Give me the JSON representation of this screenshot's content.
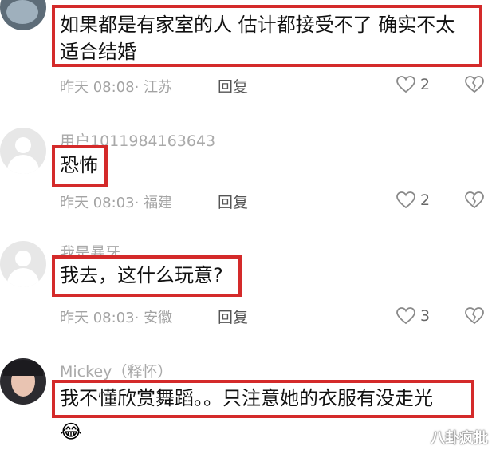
{
  "comments": [
    {
      "text_line1": "如果都是有家室的人 估计都接受不了 确实不太",
      "text_line2": "适合结婚",
      "time": "昨天 08:08",
      "location": "江苏",
      "reply": "回复",
      "likes": "2"
    },
    {
      "username": "用户1011984163643",
      "text": "恐怖",
      "time": "昨天 08:03",
      "location": "福建",
      "reply": "回复",
      "likes": "2"
    },
    {
      "username": "我是暴牙",
      "text": "我去，这什么玩意?",
      "time": "昨天 08:03",
      "location": "安徽",
      "reply": "回复",
      "likes": "3"
    },
    {
      "username": "Mickey（释怀）",
      "text": "我不懂欣赏舞蹈。。只注意她的衣服有没走光",
      "emoji": "😂"
    }
  ],
  "watermark": "八卦疯批"
}
